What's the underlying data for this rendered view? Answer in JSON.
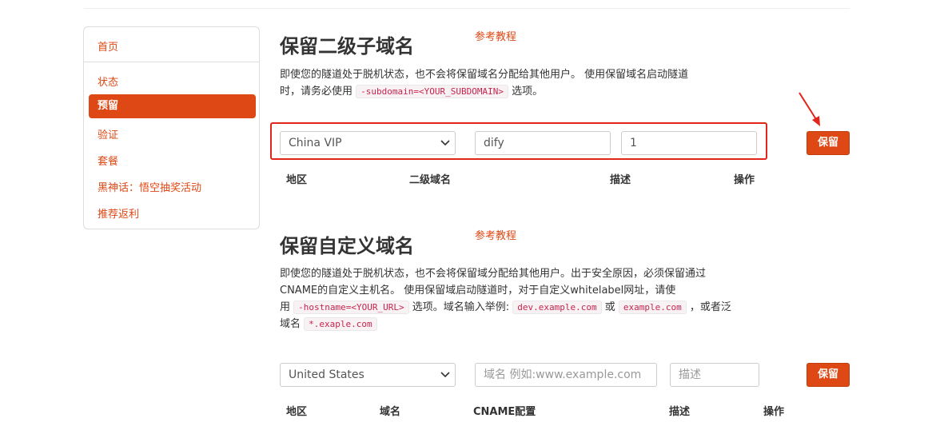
{
  "sidebar": {
    "items": [
      {
        "label": "首页"
      },
      {
        "label": "状态"
      },
      {
        "label": "预留"
      },
      {
        "label": "验证"
      },
      {
        "label": "套餐"
      },
      {
        "label": "黑神话：悟空抽奖活动"
      },
      {
        "label": "推荐返利"
      }
    ],
    "active": "预留"
  },
  "subdomain_section": {
    "title": "保留二级子域名",
    "ref_link": "参考教程",
    "desc_line1": "即使您的隧道处于脱机状态，也不会将保留域名分配给其他用户。 使用保留域名启动隧道",
    "desc_line2_a": "时，请务必使用",
    "desc_code": "-subdomain=<YOUR_SUBDOMAIN>",
    "desc_line2_b": "选项。",
    "region_select": "China VIP",
    "subdomain_value": "dify",
    "description_value": "1",
    "save_button": "保留",
    "columns": [
      "地区",
      "二级域名",
      "描述",
      "操作"
    ]
  },
  "custom_section": {
    "title": "保留自定义域名",
    "ref_link": "参考教程",
    "desc_line1": "即使您的隧道处于脱机状态，也不会将保留域分配给其他用户。出于安全原因，必须保留通过",
    "desc_line2": "CNAME的自定义主机名。 使用保留域启动隧道时，对于自定义whitelabel网址，请使",
    "desc_line3_a": "用",
    "desc_code1": "-hostname=<YOUR_URL>",
    "desc_line3_b": "选项。域名输入举例:",
    "desc_code2": "dev.example.com",
    "desc_line3_c": "或",
    "desc_code3": "example.com",
    "desc_line3_d": "，或者泛",
    "desc_line4_a": "域名",
    "desc_code4": "*.exaple.com",
    "region_select": "United States",
    "domain_placeholder": "域名 例如:www.example.com",
    "description_placeholder": "描述",
    "save_button": "保留",
    "columns": [
      "地区",
      "域名",
      "CNAME配置",
      "描述",
      "操作"
    ]
  },
  "colors": {
    "accent": "#dd4814",
    "highlight": "#e1251b"
  },
  "icons": [
    "chevron-down-icon",
    "arrow-annotation-icon"
  ]
}
